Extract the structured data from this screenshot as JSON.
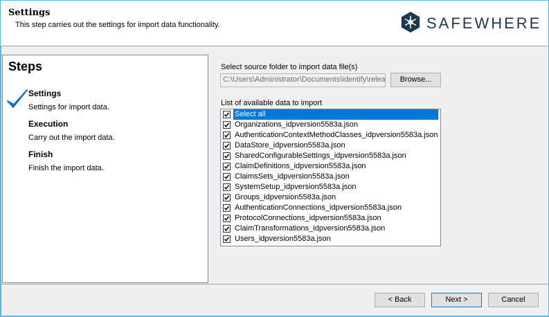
{
  "header": {
    "title": "Settings",
    "subtitle": "This step carries out the settings for import data functionality.",
    "logo_text": "SAFEWHERE"
  },
  "steps": {
    "title": "Steps",
    "items": [
      {
        "name": "Settings",
        "description": "Settings for import data.",
        "completed": true
      },
      {
        "name": "Execution",
        "description": "Carry out the import data.",
        "completed": false
      },
      {
        "name": "Finish",
        "description": "Finish the import data.",
        "completed": false
      }
    ]
  },
  "source": {
    "label": "Select source folder to import data file(s)",
    "path_value": "C:\\Users\\Administrator\\Documents\\identify\\relea",
    "browse_label": "Browse..."
  },
  "data_list": {
    "label": "List of available data to import",
    "items": [
      {
        "label": "Select all",
        "checked": true,
        "selected": true
      },
      {
        "label": "Organizations_idpversion5583a.json",
        "checked": true
      },
      {
        "label": "AuthenticationContextMethodClasses_idpversion5583a.json",
        "checked": true
      },
      {
        "label": "DataStore_idpversion5583a.json",
        "checked": true
      },
      {
        "label": "SharedConfigurableSettings_idpversion5583a.json",
        "checked": true
      },
      {
        "label": "ClaimDefinitions_idpversion5583a.json",
        "checked": true
      },
      {
        "label": "ClaimsSets_idpversion5583a.json",
        "checked": true
      },
      {
        "label": "SystemSetup_idpversion5583a.json",
        "checked": true
      },
      {
        "label": "Groups_idpversion5583a.json",
        "checked": true
      },
      {
        "label": "AuthenticationConnections_idpversion5583a.json",
        "checked": true
      },
      {
        "label": "ProtocolConnections_idpversion5583a.json",
        "checked": true
      },
      {
        "label": "ClaimTransformations_idpversion5583a.json",
        "checked": true
      },
      {
        "label": "Users_idpversion5583a.json",
        "checked": true
      }
    ]
  },
  "footer": {
    "back_label": "< Back",
    "next_label": "Next >",
    "cancel_label": "Cancel"
  },
  "colors": {
    "accent": "#0078d7",
    "checkmark": "#1e6fb8",
    "logo": "#1b3a4f",
    "window_border": "#58b7e6"
  }
}
